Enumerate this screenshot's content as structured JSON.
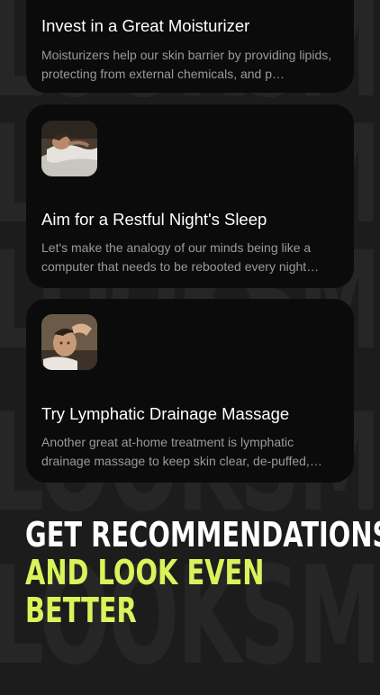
{
  "background_words": [
    "LOOKSMAX",
    "LOOKSMAX",
    "LOOKSMAX",
    "LOOKSMAX",
    "LOOKSMAX"
  ],
  "cards": [
    {
      "title": "Invest in a Great Moisturizer",
      "description": "Moisturizers help our skin barrier by providing lipids, protecting from external chemicals, and p…",
      "image": "none"
    },
    {
      "title": "Aim for a Restful Night's Sleep",
      "description": "Let's make the analogy of our minds being like a computer that needs to be rebooted every night…",
      "image": "sleeping-person-photo"
    },
    {
      "title": "Try Lymphatic Drainage Massage",
      "description": "Another great at-home treatment is lymphatic drainage massage to keep skin clear, de-puffed,…",
      "image": "face-massage-photo"
    }
  ],
  "headline": {
    "line1": "GET RECOMMENDATIONS",
    "line2": "AND LOOK EVEN",
    "line3": "BETTER"
  },
  "colors": {
    "background": "#1c1c1c",
    "card": "#0b0b0b",
    "accent": "#d8f45a",
    "text_primary": "#ffffff",
    "text_secondary": "#9a9a9a"
  }
}
